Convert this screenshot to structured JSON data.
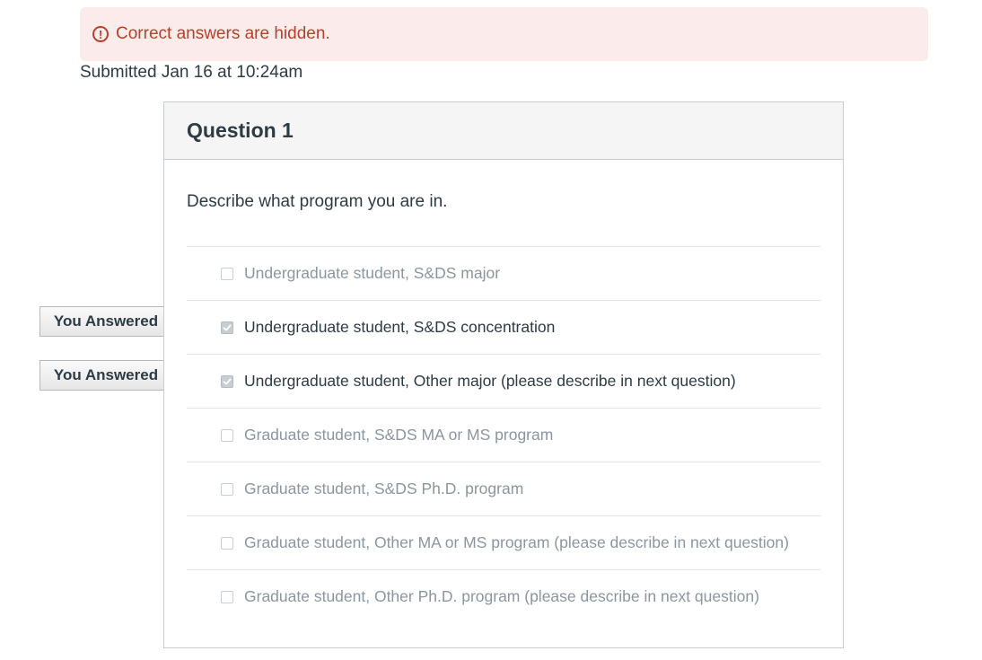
{
  "alert": {
    "text": "Correct answers are hidden.",
    "icon": "exclamation-circle-icon",
    "color": "#b7402a",
    "background": "#fbeceb"
  },
  "submitted": "Submitted Jan 16 at 10:24am",
  "question": {
    "title": "Question 1",
    "text": "Describe what program you are in.",
    "answers": [
      {
        "label": "Undergraduate student, S&DS major",
        "checked": false
      },
      {
        "label": "Undergraduate student, S&DS concentration",
        "checked": true
      },
      {
        "label": "Undergraduate student, Other major (please describe in next question)",
        "checked": true
      },
      {
        "label": "Graduate student, S&DS MA or MS program",
        "checked": false
      },
      {
        "label": "Graduate student, S&DS Ph.D. program",
        "checked": false
      },
      {
        "label": "Graduate student, Other MA or MS program (please describe in next question)",
        "checked": false
      },
      {
        "label": "Graduate student, Other Ph.D. program (please describe in next question)",
        "checked": false
      }
    ]
  },
  "tags": {
    "you_answered": "You Answered"
  }
}
